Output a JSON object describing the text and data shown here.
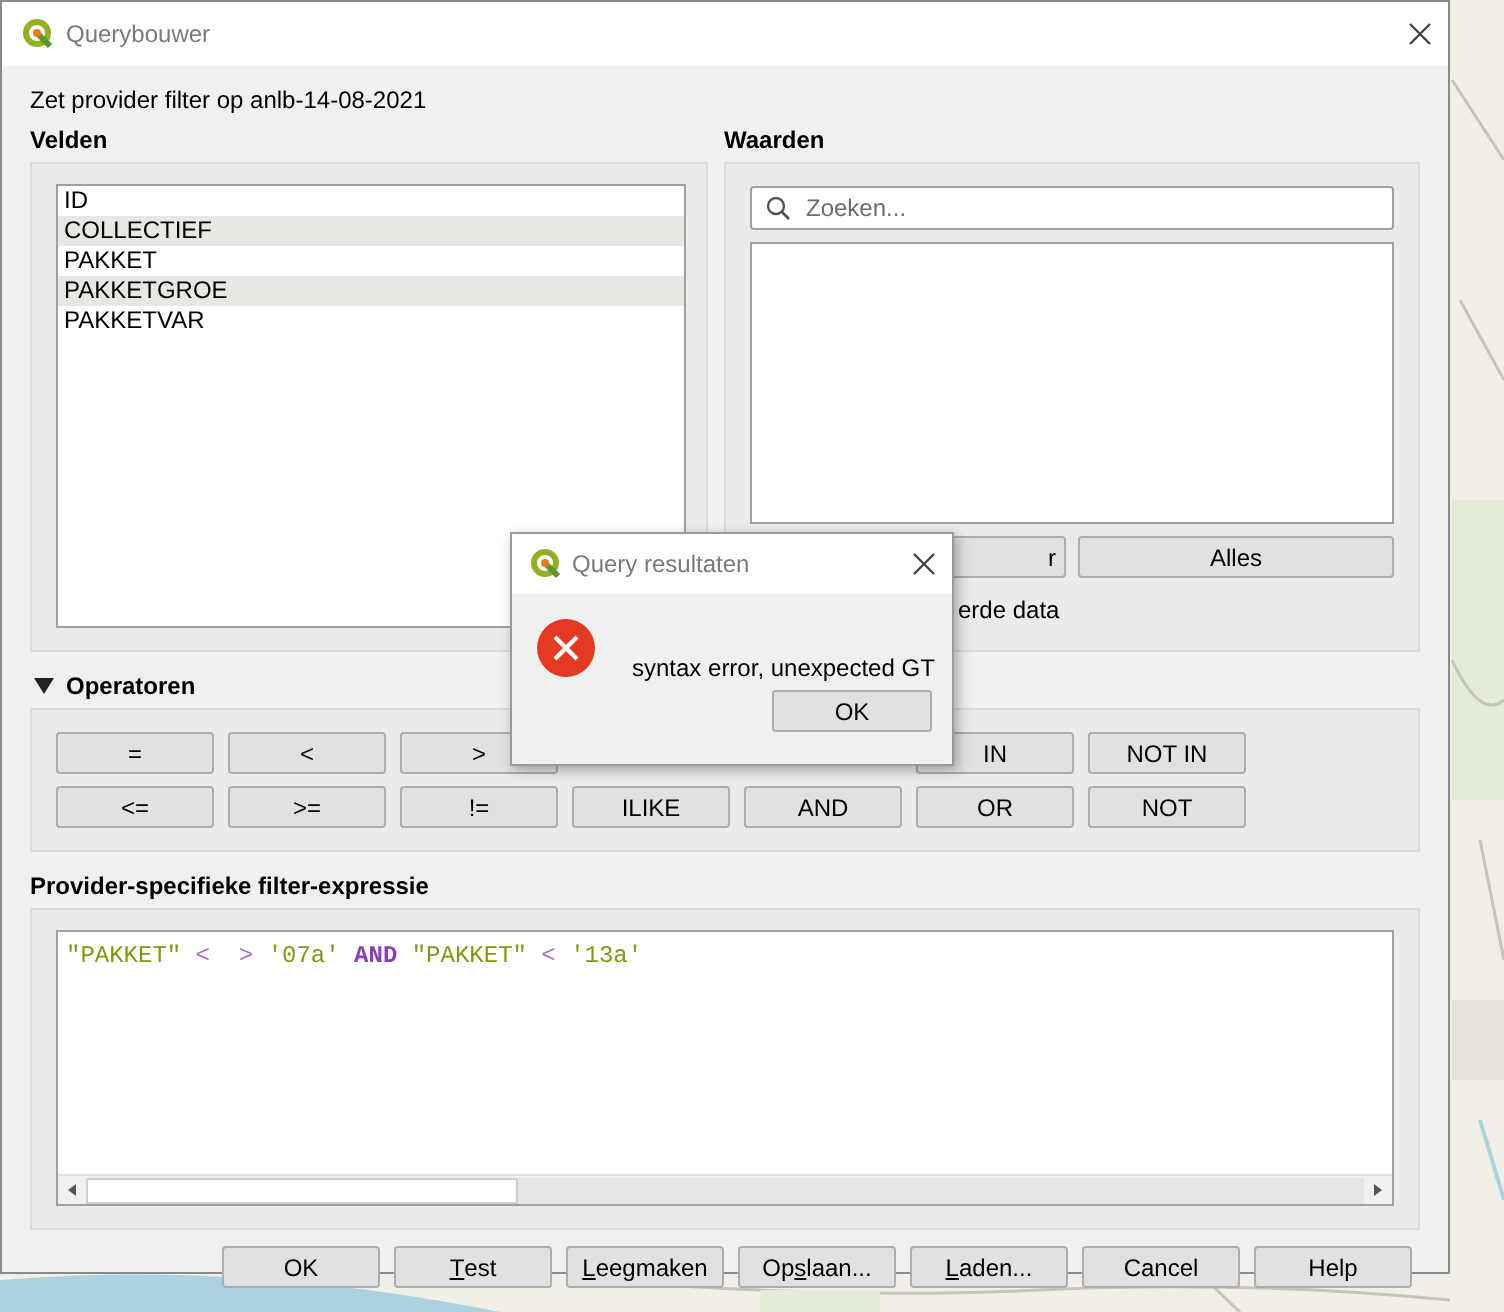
{
  "window": {
    "title": "Querybouwer"
  },
  "description": "Zet provider filter op anlb-14-08-2021",
  "fields": {
    "heading": "Velden",
    "items": [
      "ID",
      "COLLECTIEF",
      "PAKKET",
      "PAKKETGROE",
      "PAKKETVAR"
    ]
  },
  "values": {
    "heading": "Waarden",
    "search": {
      "placeholder": "Zoeken..."
    },
    "buttons": [
      "r",
      "Alles"
    ],
    "checkbox_label": "erde data"
  },
  "operators": {
    "heading": "Operatoren",
    "expanded": true,
    "rows": [
      [
        "=",
        "<",
        ">",
        null,
        null,
        "IN",
        "NOT IN"
      ],
      [
        "<=",
        ">=",
        "!=",
        "ILIKE",
        "AND",
        "OR",
        "NOT"
      ]
    ]
  },
  "expression": {
    "heading": "Provider-specifieke filter-expressie",
    "tokens": [
      {
        "kind": "field",
        "text": "\"PAKKET\""
      },
      {
        "kind": "operator",
        "text": "<  >"
      },
      {
        "kind": "string",
        "text": "'07a'"
      },
      {
        "kind": "keyword",
        "text": "AND"
      },
      {
        "kind": "field",
        "text": "\"PAKKET\""
      },
      {
        "kind": "operator",
        "text": "<"
      },
      {
        "kind": "string",
        "text": "'13a'"
      }
    ]
  },
  "buttons": [
    {
      "pre": "OK"
    },
    {
      "key": "T",
      "post": "est"
    },
    {
      "key": "L",
      "post": "eegmaken"
    },
    {
      "pre": "Op",
      "key": "s",
      "post": "laan..."
    },
    {
      "key": "L",
      "post": "aden..."
    },
    {
      "pre": "Cancel"
    },
    {
      "pre": "Help"
    }
  ],
  "message_box": {
    "title": "Query resultaten",
    "kind": "error",
    "message": "syntax error, unexpected GT",
    "button": "OK"
  }
}
